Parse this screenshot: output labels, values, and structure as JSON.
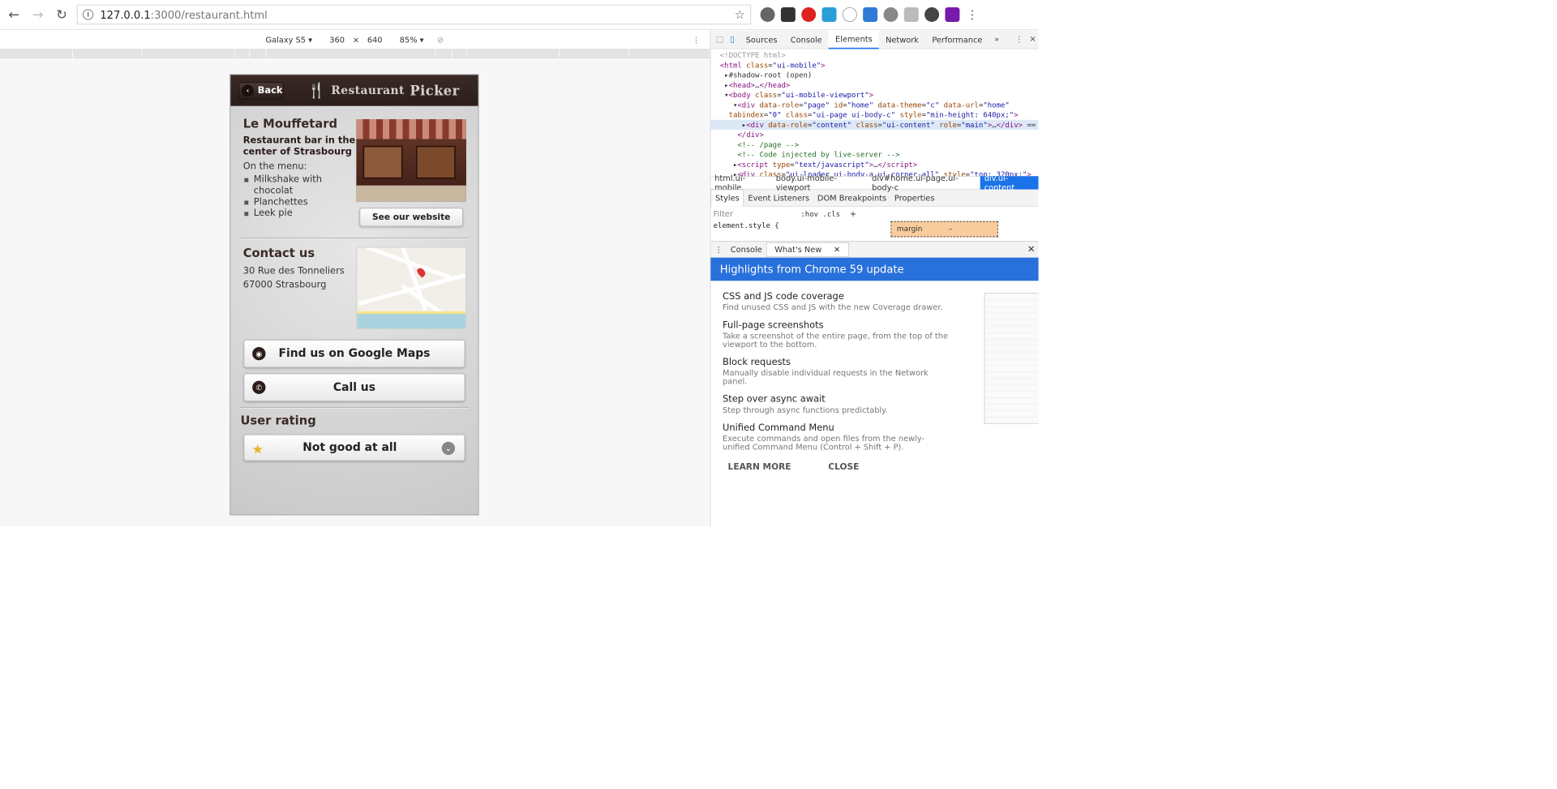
{
  "browser": {
    "url_host": "127.0.0.1",
    "url_path": ":3000/restaurant.html"
  },
  "device_toolbar": {
    "device": "Galaxy S5",
    "width": "360",
    "times": "×",
    "height": "640",
    "zoom": "85%"
  },
  "app": {
    "back_label": "Back",
    "logo_text_1": "Restaurant",
    "logo_text_2": "Picker",
    "restaurant_name": "Le Mouffetard",
    "subtitle": "Restaurant bar in the center of Strasbourg",
    "menu_label": "On the menu:",
    "menu_items": [
      "Milkshake with chocolat",
      "Planchettes",
      "Leek pie"
    ],
    "website_button": "See our website",
    "contact_title": "Contact us",
    "address_line1": "30 Rue des Tonneliers",
    "address_line2": "67000 Strasbourg",
    "maps_button": "Find us on Google Maps",
    "call_button": "Call us",
    "rating_title": "User rating",
    "rating_value": "Not good at all"
  },
  "devtools": {
    "tabs": [
      "Sources",
      "Console",
      "Elements",
      "Network",
      "Performance"
    ],
    "active_tab": "Elements",
    "breadcrumbs": [
      "html.ui-mobile",
      "body.ui-mobile-viewport",
      "div#home.ui-page.ui-body-c",
      "div.ui-content"
    ],
    "style_tabs": [
      "Styles",
      "Event Listeners",
      "DOM Breakpoints",
      "Properties"
    ],
    "filter_placeholder": "Filter",
    "hov_cls": ":hov .cls",
    "element_style": "element.style {",
    "margin_label": "margin",
    "margin_value": "–",
    "drawer_tabs": [
      "Console",
      "What's New"
    ],
    "banner": "Highlights from Chrome 59 update",
    "whats_new": [
      {
        "h": "CSS and JS code coverage",
        "d": "Find unused CSS and JS with the new Coverage drawer."
      },
      {
        "h": "Full-page screenshots",
        "d": "Take a screenshot of the entire page, from the top of the viewport to the bottom."
      },
      {
        "h": "Block requests",
        "d": "Manually disable individual requests in the Network panel."
      },
      {
        "h": "Step over async await",
        "d": "Step through async functions predictably."
      },
      {
        "h": "Unified Command Menu",
        "d": "Execute commands and open files from the newly-unified Command Menu (Control + Shift + P)."
      }
    ],
    "learn_more": "LEARN MORE",
    "close": "CLOSE"
  }
}
